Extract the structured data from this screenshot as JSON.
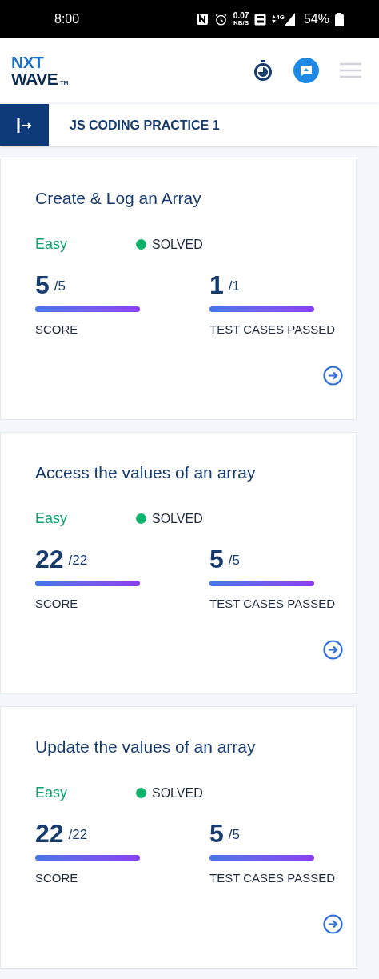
{
  "status_bar": {
    "time": "8:00",
    "speed": "0.07",
    "speed_unit": "KB/S",
    "network": "4G",
    "battery": "54%"
  },
  "header": {
    "logo": {
      "line1": "NXT",
      "line2": "WAVE",
      "mark": "TM"
    }
  },
  "subheader": {
    "title": "JS CODING PRACTICE 1"
  },
  "problems": [
    {
      "title": "Create & Log an Array",
      "difficulty": "Easy",
      "status": "SOLVED",
      "color": "#10b36b",
      "score": {
        "value": "5",
        "total": "/5",
        "label": "SCORE",
        "level": 1
      },
      "tests": {
        "value": "1",
        "total": "/1",
        "label": "TEST CASES PASSED",
        "level": 1
      }
    },
    {
      "title": "Access the values of an array",
      "difficulty": "Easy",
      "status": "SOLVED",
      "color": "#10b36b",
      "score": {
        "value": "22",
        "total": "/22",
        "label": "SCORE",
        "level": 1
      },
      "tests": {
        "value": "5",
        "total": "/5",
        "label": "TEST CASES PASSED",
        "level": 1
      }
    },
    {
      "title": "Update the values of an array",
      "difficulty": "Easy",
      "status": "SOLVED",
      "color": "#10b36b",
      "score": {
        "value": "22",
        "total": "/22",
        "label": "SCORE",
        "level": 1
      },
      "tests": {
        "value": "5",
        "total": "/5",
        "label": "TEST CASES PASSED",
        "level": 1
      }
    }
  ]
}
